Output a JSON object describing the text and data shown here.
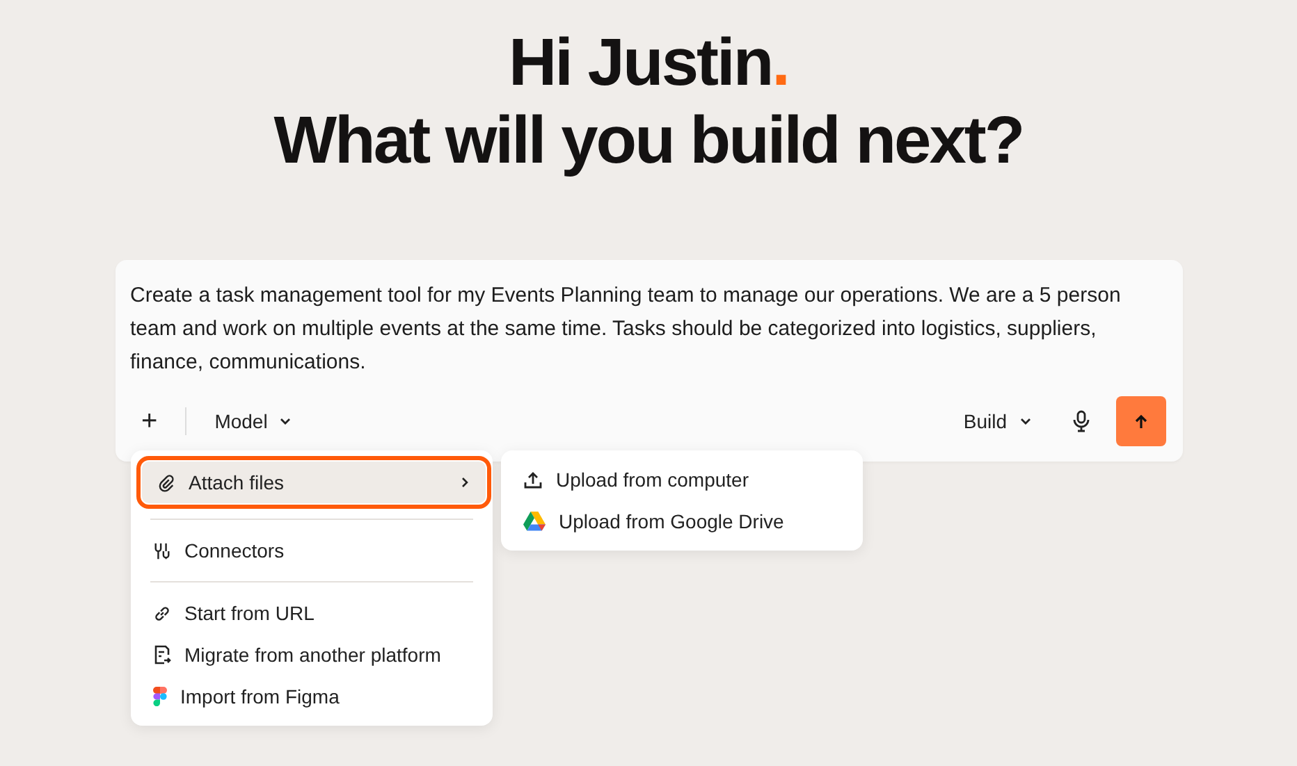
{
  "greeting": {
    "line_1": "Hi Justin",
    "accent": ".",
    "line_2": "What will you build next?"
  },
  "prompt": {
    "value": "Create a task management tool for my Events Planning team to manage our operations. We are a 5 person team and work on multiple events at the same time. Tasks should be categorized into logistics, suppliers, finance, communications.",
    "add_button": "+",
    "model_label": "Model",
    "mode_label": "Build"
  },
  "menu": {
    "groups": [
      [
        {
          "label": "Attach files",
          "selected": true,
          "has_submenu": true
        }
      ],
      [
        {
          "label": "Connectors",
          "selected": false,
          "has_submenu": false
        }
      ],
      [
        {
          "label": "Start from URL",
          "selected": false,
          "has_submenu": false
        },
        {
          "label": "Migrate from another platform",
          "selected": false,
          "has_submenu": false
        },
        {
          "label": "Import from Figma",
          "selected": false,
          "has_submenu": false
        }
      ]
    ]
  },
  "submenu": {
    "items": [
      {
        "label": "Upload from computer"
      },
      {
        "label": "Upload from Google Drive"
      }
    ]
  }
}
